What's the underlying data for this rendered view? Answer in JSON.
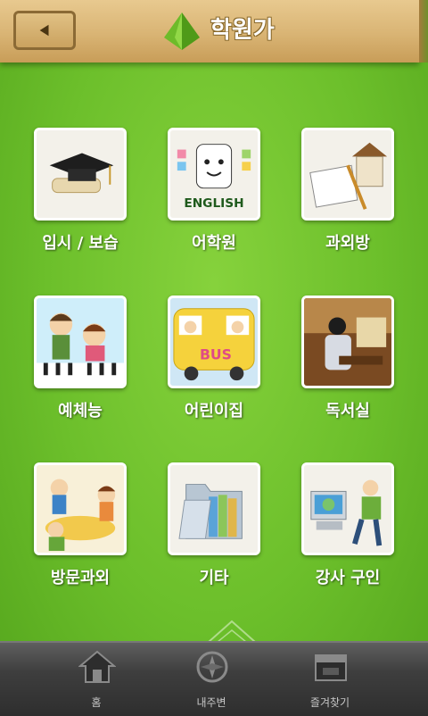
{
  "header": {
    "title": "학원가",
    "back_icon": "back-arrow-icon",
    "logo_icon": "green-pyramid-logo-icon"
  },
  "categories": [
    {
      "label": "입시 / 보습",
      "icon": "graduation-cap-icon"
    },
    {
      "label": "어학원",
      "icon": "english-icon",
      "icon_text": "ENGLISH"
    },
    {
      "label": "과외방",
      "icon": "study-desk-icon"
    },
    {
      "label": "예체능",
      "icon": "music-kids-icon"
    },
    {
      "label": "어린이집",
      "icon": "school-bus-icon",
      "icon_text": "BUS"
    },
    {
      "label": "독서실",
      "icon": "reading-room-icon"
    },
    {
      "label": "방문과외",
      "icon": "home-tutor-icon"
    },
    {
      "label": "기타",
      "icon": "folder-books-icon"
    },
    {
      "label": "강사 구인",
      "icon": "teacher-computer-icon"
    }
  ],
  "tabbar": {
    "tabs": [
      {
        "label": "홈",
        "icon": "home-icon"
      },
      {
        "label": "내주변",
        "icon": "compass-icon"
      },
      {
        "label": "즐겨찾기",
        "icon": "favorites-icon"
      }
    ]
  },
  "colors": {
    "background": "#6cbf2b",
    "header": "#d9b474",
    "tabbar": "#3e3e3e"
  }
}
